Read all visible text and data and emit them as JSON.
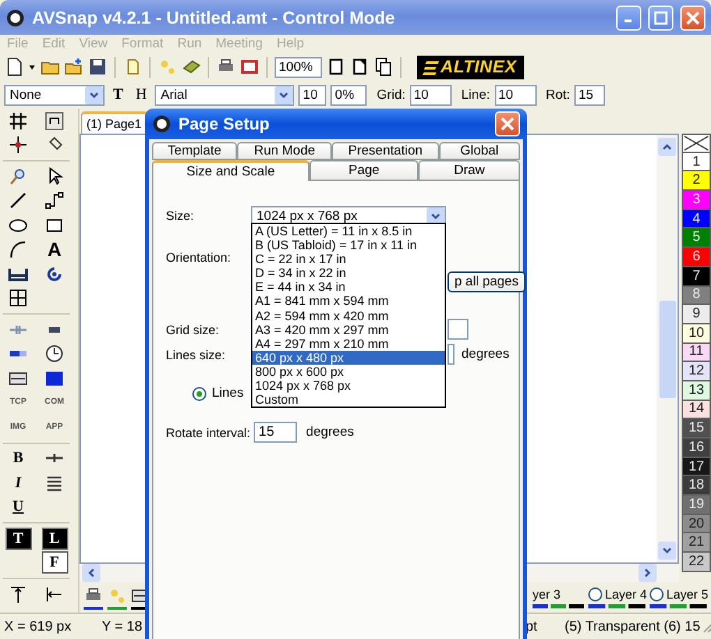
{
  "window": {
    "title": "AVSnap v4.2.1 - Untitled.amt  - Control Mode"
  },
  "menu": [
    {
      "label": "File",
      "disabled": true
    },
    {
      "label": "Edit",
      "disabled": true
    },
    {
      "label": "View",
      "disabled": true
    },
    {
      "label": "Format",
      "disabled": true
    },
    {
      "label": "Run",
      "disabled": true
    },
    {
      "label": "Meeting",
      "disabled": true
    },
    {
      "label": "Help",
      "disabled": true
    }
  ],
  "toolbar": {
    "zoom": "100%",
    "logo": "ALTINEX"
  },
  "format_bar": {
    "style": "None",
    "t_toggle": "T",
    "h_toggle": "H",
    "font": "Arial",
    "font_size": "10",
    "percent": "0%",
    "grid_label": "Grid:",
    "grid": "10",
    "line_label": "Line:",
    "line": "10",
    "rot_label": "Rot:",
    "rot": "15"
  },
  "page_tabs": [
    {
      "label": "(1) Page1",
      "selected": true
    }
  ],
  "toolbox": [
    "A",
    "TCP",
    "COM",
    "IMG",
    "APP",
    "B",
    "I",
    "U",
    "T",
    "L",
    "F"
  ],
  "palette": [
    {
      "label": "1",
      "color": "#ffffff"
    },
    {
      "label": "2",
      "color": "#ffff00"
    },
    {
      "label": "3",
      "color": "#ff00ff"
    },
    {
      "label": "4",
      "color": "#0000ff"
    },
    {
      "label": "5",
      "color": "#008000"
    },
    {
      "label": "6",
      "color": "#ff0000"
    },
    {
      "label": "7",
      "color": "#000000"
    },
    {
      "label": "8",
      "color": "#808080"
    },
    {
      "label": "9",
      "color": "#ececec"
    },
    {
      "label": "10",
      "color": "#ffffe0"
    },
    {
      "label": "11",
      "color": "#f8d8f4"
    },
    {
      "label": "12",
      "color": "#e4e4f8"
    },
    {
      "label": "13",
      "color": "#e0f8e0"
    },
    {
      "label": "14",
      "color": "#fbe0e0"
    },
    {
      "label": "15",
      "color": "#505050"
    },
    {
      "label": "16",
      "color": "#404040"
    },
    {
      "label": "17",
      "color": "#181818"
    },
    {
      "label": "18",
      "color": "#3c3c3c"
    },
    {
      "label": "19",
      "color": "#707070"
    },
    {
      "label": "20",
      "color": "#8c8c8c"
    },
    {
      "label": "21",
      "color": "#a0a0a0"
    },
    {
      "label": "22",
      "color": "#c8c8c8"
    }
  ],
  "layers": [
    {
      "kind": "cut",
      "label": "yer 3"
    },
    {
      "kind": "radio",
      "label": "Layer 4",
      "selected": false
    },
    {
      "kind": "radio",
      "label": "Layer 5",
      "selected": false
    }
  ],
  "status_bar": {
    "x": "X = 619 px",
    "y": "Y = 18",
    "cell_3": "pt",
    "cell_4": "(5) Transparent (6) 15"
  },
  "dialog": {
    "title": "Page Setup",
    "tabs_row_1": [
      {
        "label": "Template",
        "selected": false
      },
      {
        "label": "Run Mode",
        "selected": false
      },
      {
        "label": "Presentation",
        "selected": false
      },
      {
        "label": "Global",
        "selected": false
      }
    ],
    "tabs_row_2": [
      {
        "label": "Size and Scale",
        "selected": true
      },
      {
        "label": "Page",
        "selected": false
      },
      {
        "label": "Draw",
        "selected": false
      }
    ],
    "size_label": "Size:",
    "size_value": "1024 px x 768 px",
    "size_options": [
      {
        "label": "A (US Letter) = 11 in x 8.5 in",
        "selected": false
      },
      {
        "label": "B (US Tabloid) = 17 in x 11 in",
        "selected": false
      },
      {
        "label": "C = 22 in x 17 in",
        "selected": false
      },
      {
        "label": "D = 34 in x 22 in",
        "selected": false
      },
      {
        "label": "E = 44 in x 34 in",
        "selected": false
      },
      {
        "label": "A1 = 841 mm x 594 mm",
        "selected": false
      },
      {
        "label": "A2 = 594 mm x 420 mm",
        "selected": false
      },
      {
        "label": "A3 = 420 mm x 297 mm",
        "selected": false
      },
      {
        "label": "A4 = 297 mm x 210 mm",
        "selected": false
      },
      {
        "label": "640 px x 480 px",
        "selected": true
      },
      {
        "label": "800 px x 600 px",
        "selected": false
      },
      {
        "label": "1024 px x 768 px",
        "selected": false
      },
      {
        "label": "Custom",
        "selected": false
      }
    ],
    "orientation_label": "Orientation:",
    "apply_button": "p all pages",
    "grid_size_label": "Grid size:",
    "lines_size_label": "Lines size:",
    "lines_degrees": "degrees",
    "lines_radio": {
      "label": "Lines",
      "selected": true
    },
    "rotate_label": "Rotate interval:",
    "rotate_value": "15",
    "rotate_degrees": "degrees"
  }
}
